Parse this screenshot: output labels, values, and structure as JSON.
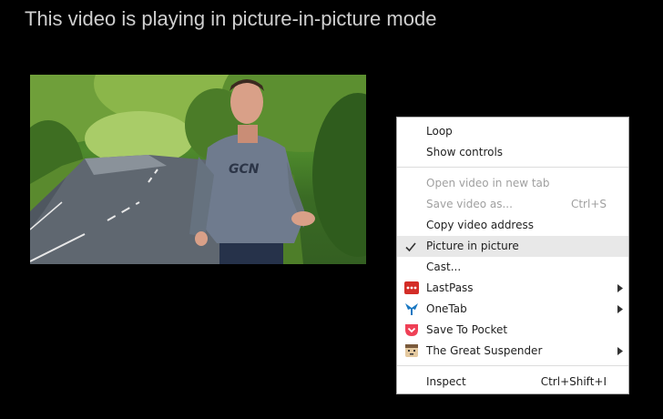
{
  "page": {
    "message": "This video is playing in picture-in-picture mode"
  },
  "video": {
    "jacket_logo": "GCN"
  },
  "context_menu": {
    "loop": "Loop",
    "show_controls": "Show controls",
    "open_video": "Open video in new tab",
    "save_video": "Save video as...",
    "save_video_shortcut": "Ctrl+S",
    "copy_address": "Copy video address",
    "picture_in_picture": "Picture in picture",
    "picture_in_picture_checked": true,
    "cast": "Cast...",
    "extensions": {
      "lastpass": {
        "label": "LastPass",
        "icon": "lastpass-icon",
        "color": "#d32d27"
      },
      "onetab": {
        "label": "OneTab",
        "icon": "onetab-icon",
        "color": "#1a78c2"
      },
      "pocket": {
        "label": "Save To Pocket",
        "icon": "pocket-icon",
        "color": "#ef4056"
      },
      "suspender": {
        "label": "The Great Suspender",
        "icon": "great-suspender-icon",
        "color": "#e4c9a0"
      }
    },
    "inspect": "Inspect",
    "inspect_shortcut": "Ctrl+Shift+I"
  }
}
